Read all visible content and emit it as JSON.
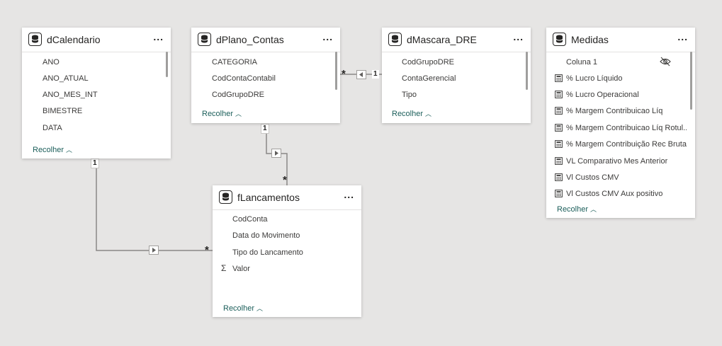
{
  "tables": {
    "dCalendario": {
      "title": "dCalendario",
      "more": "...",
      "fields": [
        "ANO",
        "ANO_ATUAL",
        "ANO_MES_INT",
        "BIMESTRE",
        "DATA"
      ],
      "collapse": "Recolher"
    },
    "dPlano_Contas": {
      "title": "dPlano_Contas",
      "more": "...",
      "fields": [
        "CATEGORIA",
        "CodContaContabil",
        "CodGrupoDRE"
      ],
      "collapse": "Recolher"
    },
    "dMascara_DRE": {
      "title": "dMascara_DRE",
      "more": "...",
      "fields": [
        "CodGrupoDRE",
        "ContaGerencial",
        "Tipo"
      ],
      "collapse": "Recolher"
    },
    "Medidas": {
      "title": "Medidas",
      "more": "...",
      "column1": "Coluna 1",
      "measures": [
        "% Lucro Líquido",
        "% Lucro Operacional",
        "% Margem Contribuicao Líq",
        "% Margem Contribuicao Líq Rotul...",
        "% Margem Contribuição Rec Bruta",
        "VL Comparativo Mes Anterior",
        "Vl Custos CMV",
        "Vl Custos CMV Aux positivo"
      ],
      "collapse": "Recolher"
    },
    "fLancamentos": {
      "title": "fLancamentos",
      "more": "...",
      "fields": [
        "CodConta",
        "Data do Movimento",
        "Tipo do Lancamento"
      ],
      "sum_field": "Valor",
      "sum_symbol": "Σ",
      "collapse": "Recolher"
    }
  },
  "relationships": {
    "plano_mascara": {
      "many": "*",
      "one": "1"
    },
    "plano_lanc": {
      "one": "1",
      "many": "*"
    },
    "cal_lanc": {
      "one": "1",
      "many": "*"
    }
  },
  "icons": {
    "table": "database-icon",
    "measure": "calculator-icon",
    "hidden": "eye-hidden-icon",
    "filter_arrow": "filter-direction-arrow-icon"
  },
  "colors": {
    "canvas": "#e6e5e4",
    "collapse_link": "#1b5e5a"
  }
}
